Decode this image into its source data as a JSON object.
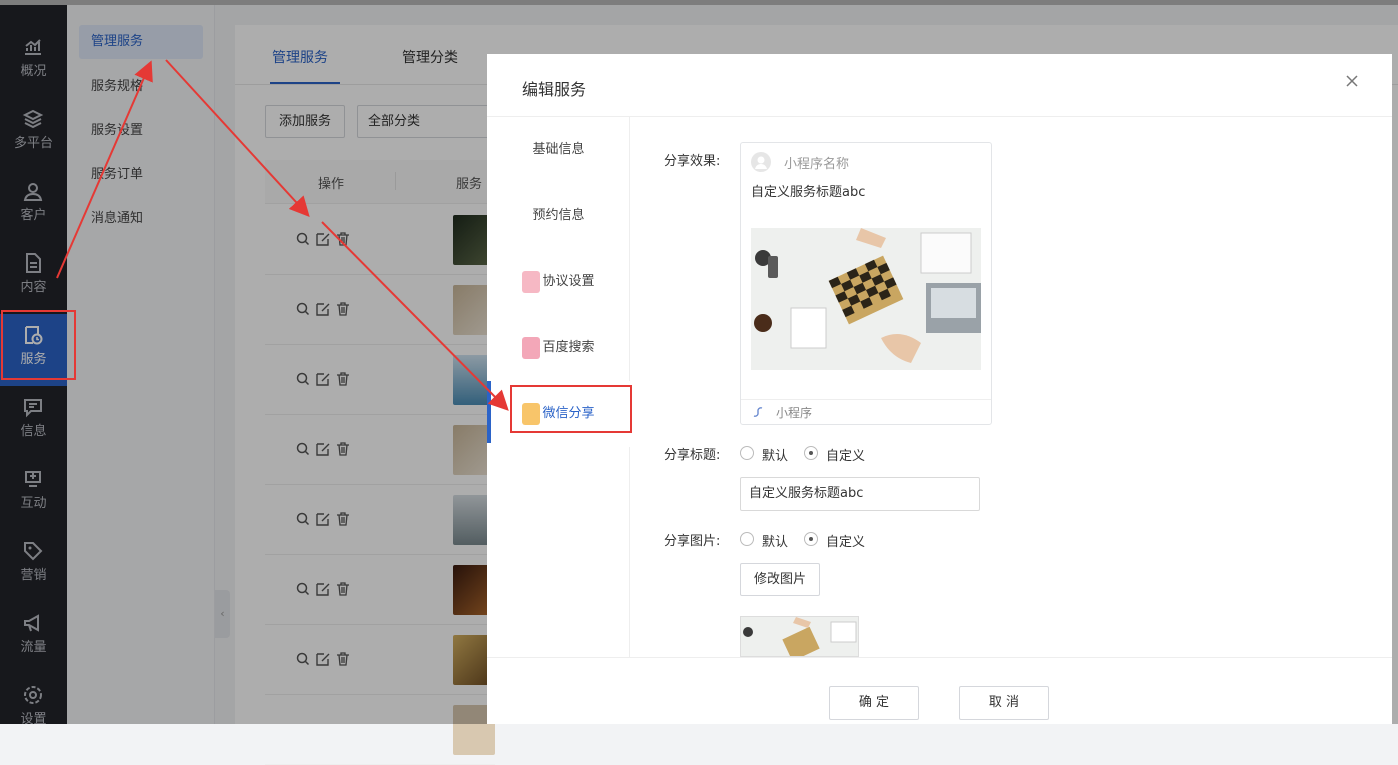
{
  "leftnav": {
    "items": [
      {
        "label": "概况",
        "icon": "chart-trend-icon"
      },
      {
        "label": "多平台",
        "icon": "layers-icon"
      },
      {
        "label": "客户",
        "icon": "user-icon"
      },
      {
        "label": "内容",
        "icon": "document-icon"
      },
      {
        "label": "服务",
        "icon": "service-icon"
      },
      {
        "label": "信息",
        "icon": "message-icon"
      },
      {
        "label": "互动",
        "icon": "interaction-icon"
      },
      {
        "label": "营销",
        "icon": "tag-icon"
      },
      {
        "label": "流量",
        "icon": "megaphone-icon"
      },
      {
        "label": "设置",
        "icon": "settings-icon"
      }
    ],
    "active_index": 4
  },
  "subnav": {
    "items": [
      "管理服务",
      "服务规格",
      "服务设置",
      "服务订单",
      "消息通知"
    ]
  },
  "main": {
    "tabs": [
      "管理服务",
      "管理分类"
    ],
    "add_button": "添加服务",
    "category_select": "全部分类",
    "columns": [
      "操作",
      "服务"
    ]
  },
  "modal": {
    "title": "编辑服务",
    "side_items": [
      "基础信息",
      "预约信息",
      "协议设置",
      "百度搜索",
      "微信分享"
    ],
    "active_side": "微信分享",
    "share_effect_label": "分享效果:",
    "preview": {
      "mini_program_name": "小程序名称",
      "title": "自定义服务标题abc",
      "footer": "小程序"
    },
    "share_title_label": "分享标题:",
    "share_image_label": "分享图片:",
    "option_default": "默认",
    "option_custom": "自定义",
    "share_title_value": "自定义服务标题abc",
    "modify_image_button": "修改图片",
    "confirm": "确 定",
    "cancel": "取 消"
  },
  "colors": {
    "accent": "#2b63c8",
    "sidebar_bg": "#23242a",
    "annotation_red": "#e53935"
  }
}
